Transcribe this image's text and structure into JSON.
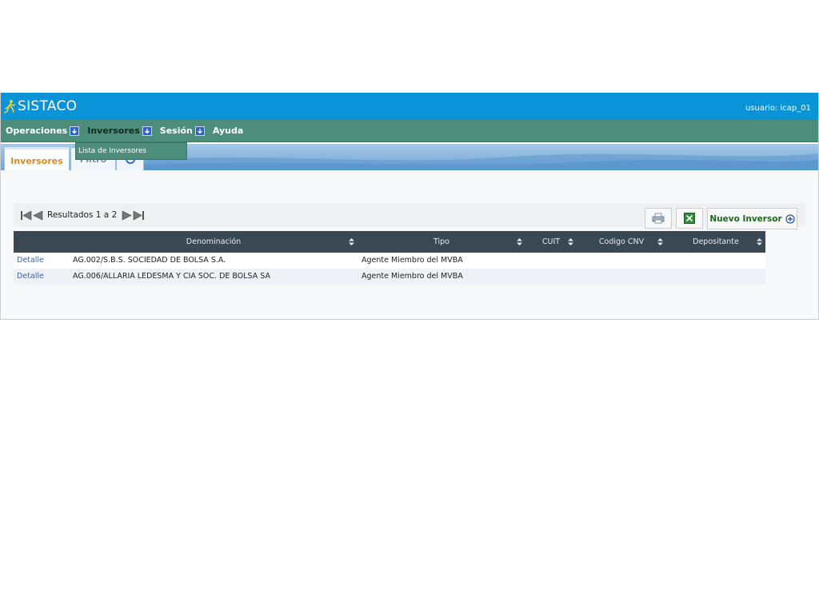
{
  "header": {
    "app_title": "SISTACO",
    "user_label": "usuario: icap_01"
  },
  "menu": {
    "items": [
      {
        "label": "Operaciones",
        "has_arrow": true
      },
      {
        "label": "Inversores",
        "has_arrow": true
      },
      {
        "label": "Sesión",
        "has_arrow": true
      },
      {
        "label": "Ayuda",
        "has_arrow": false
      }
    ],
    "dropdown": {
      "items": [
        {
          "label": "Lista de Inversores"
        }
      ]
    }
  },
  "tabs": [
    {
      "label": "Inversores"
    },
    {
      "label": "Filtro"
    }
  ],
  "pager": {
    "results_label": "Resultados 1 a 2"
  },
  "toolbar": {
    "new_label": "Nuevo Inversor"
  },
  "table": {
    "columns": [
      "",
      "Denominación",
      "Tipo",
      "CUIT",
      "Codigo CNV",
      "Depositante"
    ],
    "rows": [
      {
        "action": "Detalle",
        "denominacion": "AG.002/S.B.S. SOCIEDAD DE BOLSA S.A.",
        "tipo": "Agente Miembro del MVBA",
        "cuit": "",
        "codigo_cnv": "",
        "depositante": ""
      },
      {
        "action": "Detalle",
        "denominacion": "AG.006/ALLARIA LEDESMA Y CIA SOC. DE BOLSA SA",
        "tipo": "Agente Miembro del MVBA",
        "cuit": "",
        "codigo_cnv": "",
        "depositante": ""
      }
    ]
  },
  "icons": {
    "brand": "runner-icon",
    "menu_arrow": "arrow-down-icon",
    "refresh": "refresh-icon",
    "first": "first-page-icon",
    "prev": "prev-page-icon",
    "next": "next-page-icon",
    "last": "last-page-icon",
    "print": "print-icon",
    "excel": "excel-icon",
    "add": "plus-circle-icon",
    "sort": "sort-icon"
  },
  "colors": {
    "header_blue": "#0b93d8",
    "menu_green": "#4d8e7b",
    "table_header": "#3a4854",
    "active_tab_text": "#d88a22",
    "link": "#2a6bb3"
  }
}
